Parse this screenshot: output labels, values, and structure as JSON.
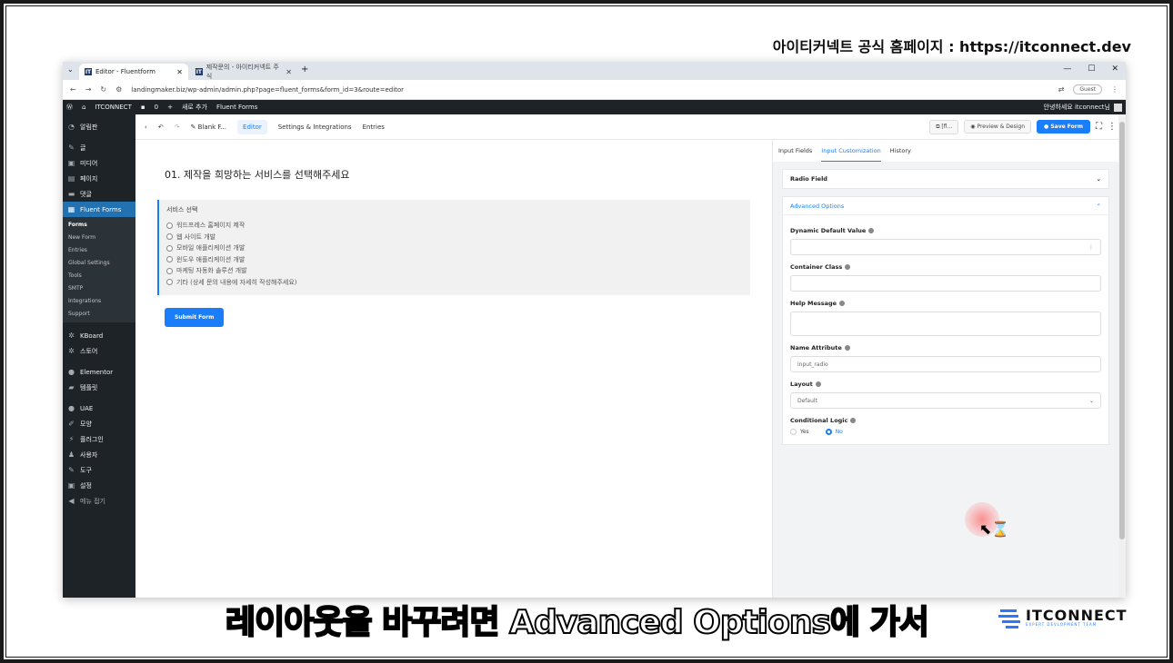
{
  "video": {
    "top_caption": "아이티커넥트 공식 홈페이지 : https://itconnect.dev",
    "subtitle": "레이아웃을 바꾸려면 Advanced Options에 가서",
    "logo_name": "ITCONNECT",
    "logo_tagline": "EXPERT DEVLOPMENT TEAM"
  },
  "browser": {
    "tabs": [
      {
        "label": "Editor - Fluentform",
        "icon": "IT",
        "active": true
      },
      {
        "label": "제작문의 - 아이티커넥트 주식",
        "icon": "IT",
        "active": false
      }
    ],
    "url": "landingmaker.biz/wp-admin/admin.php?page=fluent_forms&form_id=3&route=editor",
    "profile_label": "Guest"
  },
  "adminbar": {
    "site_name": "ITCONNECT",
    "comments_count": "0",
    "new_label": "새로 추가",
    "plugin_label": "Fluent Forms",
    "greeting": "안녕하세요 itconnect님"
  },
  "sidebar": {
    "items": [
      {
        "label": "알림판",
        "icon": "dashboard-icon"
      },
      {
        "label": "글",
        "icon": "pin-icon"
      },
      {
        "label": "미디어",
        "icon": "media-icon"
      },
      {
        "label": "페이지",
        "icon": "page-icon"
      },
      {
        "label": "댓글",
        "icon": "comment-icon"
      },
      {
        "label": "Fluent Forms",
        "icon": "form-icon",
        "current": true
      }
    ],
    "submenu": [
      "Forms",
      "New Form",
      "Entries",
      "Global Settings",
      "Tools",
      "SMTP",
      "Integrations",
      "Support"
    ],
    "items2": [
      {
        "label": "KBoard",
        "icon": "kboard-icon"
      },
      {
        "label": "스토어",
        "icon": "store-icon"
      }
    ],
    "items3": [
      {
        "label": "Elementor",
        "icon": "elementor-icon"
      },
      {
        "label": "템플릿",
        "icon": "folder-icon"
      }
    ],
    "items4": [
      {
        "label": "UAE",
        "icon": "uae-icon"
      },
      {
        "label": "모양",
        "icon": "brush-icon"
      },
      {
        "label": "플러그인",
        "icon": "plugin-icon"
      },
      {
        "label": "사용자",
        "icon": "user-icon"
      },
      {
        "label": "도구",
        "icon": "wrench-icon"
      },
      {
        "label": "설정",
        "icon": "settings-icon"
      },
      {
        "label": "메뉴 접기",
        "icon": "collapse-icon"
      }
    ]
  },
  "toolbar": {
    "form_title": "Blank F...",
    "tabs": [
      "Editor",
      "Settings & Integrations",
      "Entries"
    ],
    "shortcode_label": "[fl...",
    "preview_label": "Preview & Design",
    "save_label": "Save Form"
  },
  "form": {
    "heading": "01. 제작을 희망하는 서비스를 선택해주세요",
    "field_label": "서비스 선택",
    "options": [
      "워드프레스 홈페이지 제작",
      "웹 사이트 개발",
      "모바일 애플리케이션 개발",
      "윈도우 애플리케이션 개발",
      "마케팅 자동화 솔루션 개발",
      "기타 (상세 문의 내용에 자세히 작성해주세요)"
    ],
    "submit_label": "Submit Form"
  },
  "panel": {
    "tabs": [
      "Input Fields",
      "Input Customization",
      "History"
    ],
    "active_tab": "Input Customization",
    "field_type": "Radio Field",
    "advanced_title": "Advanced Options",
    "dynamic_default_label": "Dynamic Default Value",
    "container_class_label": "Container Class",
    "help_message_label": "Help Message",
    "name_attribute_label": "Name Attribute",
    "name_attribute_value": "input_radio",
    "layout_label": "Layout",
    "layout_value": "Default",
    "conditional_label": "Conditional Logic",
    "conditional_yes": "Yes",
    "conditional_no": "No"
  },
  "colors": {
    "accent": "#1a7efb",
    "wp_dark": "#1d2327",
    "wp_current": "#2271b1"
  }
}
